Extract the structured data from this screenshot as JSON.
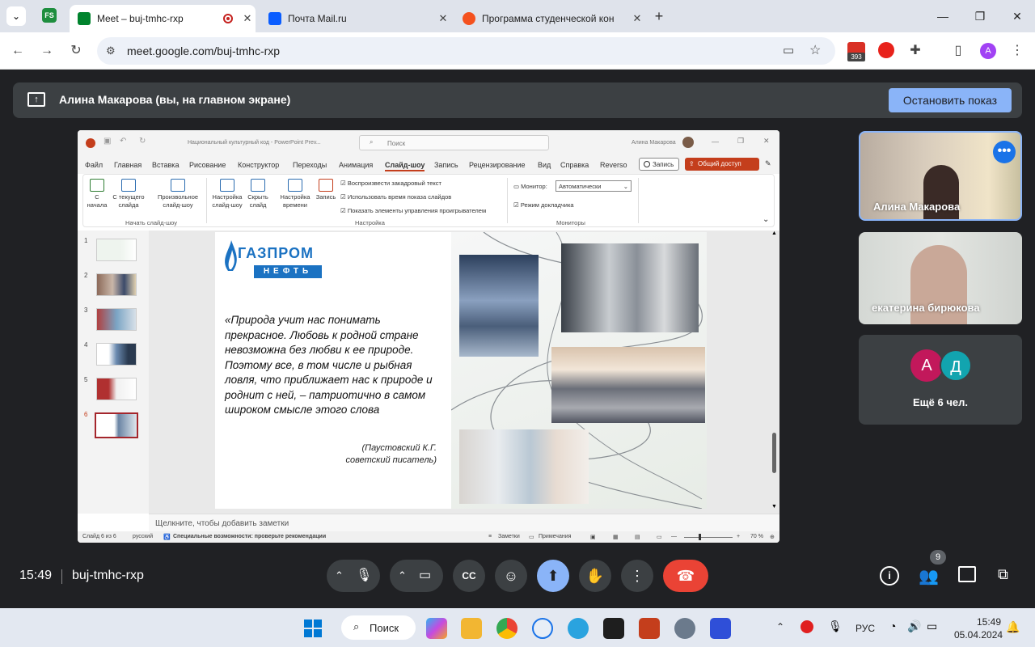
{
  "browser": {
    "tabs": [
      {
        "title": "Meet – buj-tmhc-rxp",
        "favicon_color": "#00832d",
        "active": true
      },
      {
        "title": "Почта Mail.ru",
        "favicon_color": "#0a5dff",
        "active": false
      },
      {
        "title": "Программа студенческой кон",
        "favicon_color": "#f4511e",
        "active": false
      }
    ],
    "new_tab": "+",
    "url": "meet.google.com/buj-tmhc-rxp",
    "extension_badge": "393",
    "profile_letter": "A"
  },
  "meet": {
    "present_banner": "Алина Макарова (вы, на главном экране)",
    "stop_presenting": "Остановить показ",
    "time": "15:49",
    "meeting_code": "buj-tmhc-rxp",
    "participants_count": "9",
    "participants": [
      {
        "name": "Алина Макарова"
      },
      {
        "name": "екатерина бирюкова"
      }
    ],
    "more_avatars": [
      "А",
      "Д"
    ],
    "more_label": "Ещё 6 чел."
  },
  "ppt": {
    "file_title": "Национальный культурный код  -  PowerPoint Prev...",
    "search": "Поиск",
    "user": "Алина Макарова",
    "menu": [
      "Файл",
      "Главная",
      "Вставка",
      "Рисование",
      "Конструктор",
      "Переходы",
      "Анимация",
      "Слайд-шоу",
      "Запись",
      "Рецензирование",
      "Вид",
      "Справка",
      "Reverso"
    ],
    "record_btn": "Запись",
    "share_btn": "Общий доступ",
    "ribbon": {
      "btn_from_start": "С начала",
      "btn_from_current": "С текущего слайда",
      "btn_custom": "Произвольное слайд-шоу",
      "group_start": "Начать слайд-шоу",
      "btn_setup": "Настройка слайд-шоу",
      "btn_hide": "Скрыть слайд",
      "btn_timing": "Настройка времени",
      "btn_record": "Запись",
      "cb_narration": "Воспроизвести закадровый текст",
      "cb_timings": "Использовать время показа слайдов",
      "cb_media": "Показать элементы управления проигрывателем",
      "group_setup": "Настройка",
      "monitor_label": "Монитор:",
      "monitor_value": "Автоматически",
      "cb_presenter": "Режим докладчика",
      "group_monitors": "Мониторы"
    },
    "thumb_numbers": [
      "1",
      "2",
      "3",
      "4",
      "5",
      "6"
    ],
    "slide": {
      "logo_top": "ГАЗПРОМ",
      "logo_bottom": "НЕФТЬ",
      "quote": "«Природа учит нас понимать прекрасное. Любовь к родной стране невозможна без любви к ее природе. Поэтому все, в том числе и рыбная ловля, что приближает нас к природе и роднит с ней, – патриотично в самом широком смысле этого слова",
      "author_line1": "(Паустовский К.Г.",
      "author_line2": "советский писатель)"
    },
    "notes_placeholder": "Щелкните, чтобы добавить заметки",
    "status": {
      "slide_of": "Слайд 6 из 6",
      "lang": "русский",
      "accessibility": "Специальные возможности: проверьте рекомендации",
      "notes": "Заметки",
      "comments": "Примечания",
      "zoom": "70 %"
    }
  },
  "taskbar": {
    "search": "Поиск",
    "lang": "РУС",
    "time": "15:49",
    "date": "05.04.2024"
  },
  "colors": {
    "meet_bg": "#202124",
    "accent_blue": "#8ab4f8",
    "end_call_red": "#ea4335",
    "ppt_orange": "#c43e1c"
  }
}
